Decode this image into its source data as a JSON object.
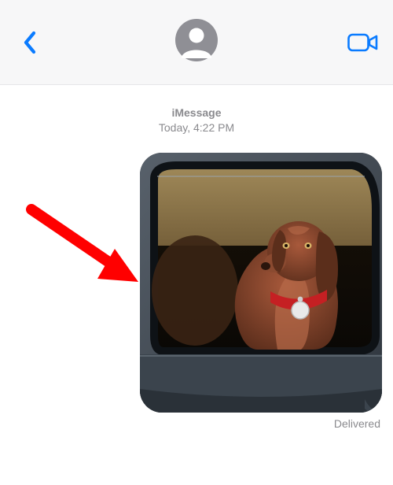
{
  "header": {
    "back_icon": "chevron-left",
    "facetime_icon": "video-camera",
    "avatar_icon": "person-silhouette"
  },
  "thread": {
    "service_label": "iMessage",
    "date_label": "Today,",
    "time_label": "4:22 PM"
  },
  "message": {
    "kind": "photo",
    "content_description": "Brown dog with red collar looking out of car window",
    "status_label": "Delivered",
    "sender": "me"
  },
  "annotation": {
    "kind": "arrow",
    "color": "#ff0000",
    "points_to": "message-photo"
  },
  "colors": {
    "ios_blue": "#0a7bff",
    "header_bg": "#f7f7f8",
    "hairline": "#e6e6e8",
    "meta_gray": "#8a8a8e",
    "avatar_bg": "#8f8f95"
  }
}
